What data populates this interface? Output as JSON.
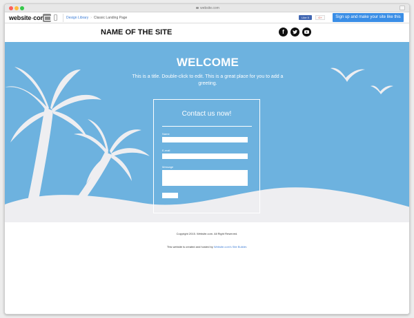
{
  "browser": {
    "url": "website.com",
    "controls": [
      "close",
      "minimize",
      "zoom"
    ]
  },
  "toolbar": {
    "brand": "website",
    "brand_suffix": "com",
    "breadcrumbs": [
      "Design Library",
      "Classic Landing Page"
    ],
    "fb_like": "Like 5",
    "gplus": "G+",
    "signup_label": "Sign up and make your site like this",
    "signup_color": "#3a8ee6"
  },
  "site": {
    "name": "NAME OF THE SITE",
    "social_icons": [
      {
        "icon": "facebook-icon",
        "glyph": "f"
      },
      {
        "icon": "twitter-icon",
        "glyph": "t"
      },
      {
        "icon": "youtube-icon",
        "glyph": "▶"
      }
    ]
  },
  "hero": {
    "title": "WELCOME",
    "greeting": "This is a title. Double-click to edit. This is a great place for you to add a greeting.",
    "background_color": "#6db2df"
  },
  "contact": {
    "title": "Contact us now!",
    "fields": [
      {
        "label": "Name",
        "value": ""
      },
      {
        "label": "E-mail",
        "value": ""
      },
      {
        "label": "Message",
        "value": ""
      }
    ],
    "submit_label": ""
  },
  "footer": {
    "copyright": "Copyright 2015. Website.com. All Right Reserved.",
    "hosted_prefix": "This website is created and hosted by ",
    "hosted_link": "Website.com's Site Builder",
    "hosted_suffix": "."
  }
}
